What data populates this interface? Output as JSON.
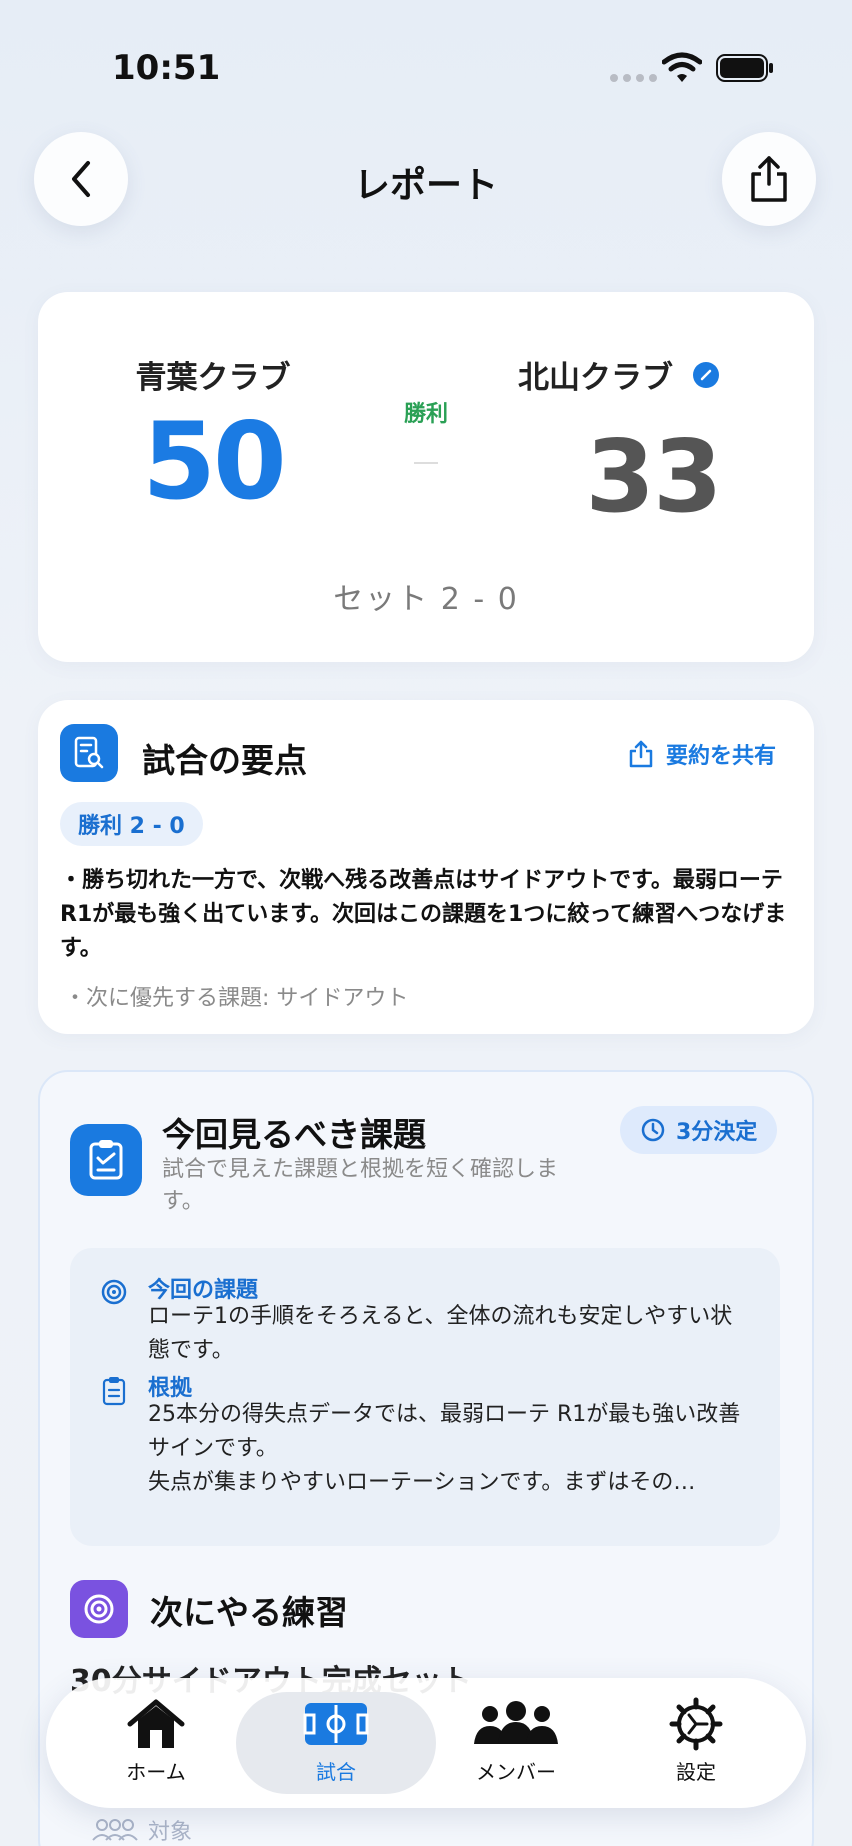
{
  "status": {
    "time": "10:51"
  },
  "header": {
    "title": "レポート"
  },
  "score": {
    "team_left": "青葉クラブ",
    "team_right": "北山クラブ",
    "score_left": "50",
    "score_right": "33",
    "result": "勝利",
    "sets": "セット 2 - 0"
  },
  "summary": {
    "title": "試合の要点",
    "share_label": "要約を共有",
    "badge": "勝利 2 - 0",
    "body": "・勝ち切れた一方で、次戦へ残る改善点はサイドアウトです。最弱ローテ R1が最も強く出ています。次回はこの課題を1つに絞って練習へつなげます。",
    "note": "・次に優先する課題: サイドアウト"
  },
  "issues": {
    "title": "今回見るべき課題",
    "subtitle": "試合で見えた課題と根拠を短く確認します。",
    "timer_label": "3分決定",
    "current_heading": "今回の課題",
    "current_text": "ローテ1の手順をそろえると、全体の流れも安定しやすい状態です。",
    "evidence_heading": "根拠",
    "evidence_text_1": "25本分の得失点データでは、最弱ローテ R1が最も強い改善サインです。",
    "evidence_text_2": "失点が集まりやすいローテーションです。まずはその…",
    "next_title": "次にやる練習",
    "next_plan": "30分サイドアウト完成セット",
    "target_label": "対象"
  },
  "tabbar": {
    "items": [
      {
        "label": "ホーム",
        "icon": "home-icon"
      },
      {
        "label": "試合",
        "icon": "court-icon"
      },
      {
        "label": "メンバー",
        "icon": "members-icon"
      },
      {
        "label": "設定",
        "icon": "gear-icon"
      }
    ],
    "active_index": 1
  },
  "colors": {
    "accent": "#1a7ae0",
    "win": "#2aa055",
    "practice": "#7a52e0"
  }
}
